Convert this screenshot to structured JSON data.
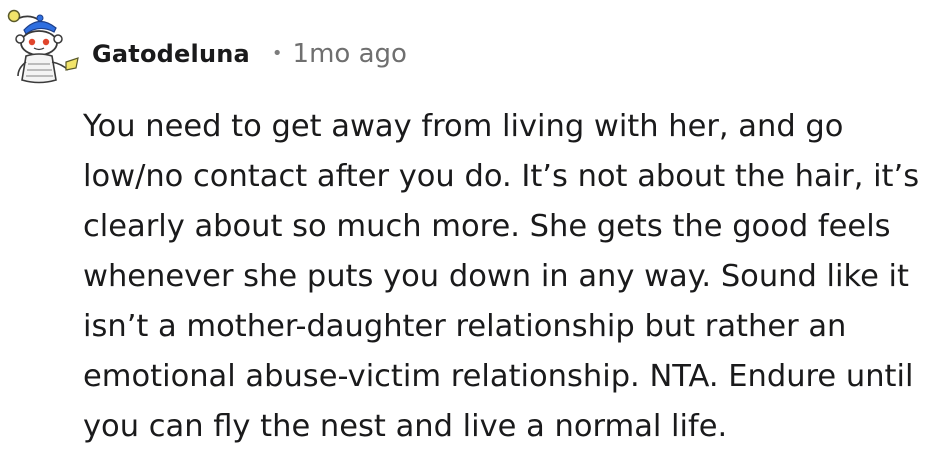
{
  "comment": {
    "author": "Gatodeluna",
    "separator": "•",
    "timestamp": "1mo ago",
    "avatar_icon": "snoo-avatar-icon",
    "body_lines": [
      "You need to get away from living with her, and go",
      "low/no contact after you do. It’s not about the hair, it’s",
      "clearly about so much more. She gets the good feels",
      "whenever she puts you down in any way. Sound like it",
      "isn’t a mother-daughter relationship but rather an",
      "emotional abuse-victim relationship. NTA. Endure until",
      "you can fly the nest and live a normal life."
    ]
  },
  "colors": {
    "text": "#1a1a1b",
    "meta": "#6f6f6f",
    "accent_blue": "#2f6fe0",
    "avatar_outline": "#3a3a3a",
    "antenna_yellow": "#e8d44a"
  }
}
